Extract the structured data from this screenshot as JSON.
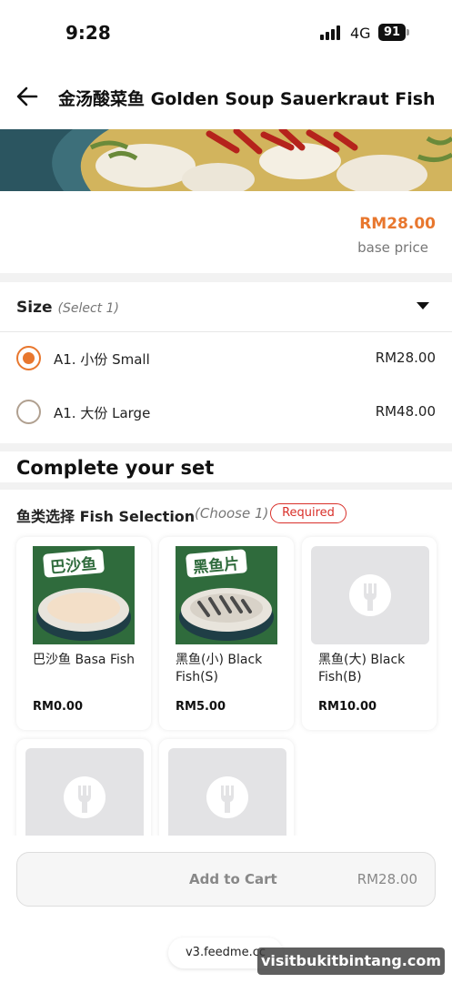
{
  "status_bar": {
    "time": "9:28",
    "network": "4G",
    "battery": "91"
  },
  "header": {
    "title": "金汤酸菜鱼 Golden Soup Sauerkraut Fish"
  },
  "price": {
    "amount": "RM28.00",
    "caption": "base price"
  },
  "size": {
    "heading": "Size",
    "hint": "(Select 1)",
    "options": [
      {
        "label": "A1. 小份 Small",
        "price": "RM28.00",
        "selected": true
      },
      {
        "label": "A1. 大份 Large",
        "price": "RM48.00",
        "selected": false
      }
    ]
  },
  "set": {
    "title": "Complete your set"
  },
  "fish": {
    "heading": "鱼类选择 Fish Selection",
    "hint": "(Choose 1)",
    "required": "Required",
    "items": [
      {
        "name": "巴沙鱼 Basa Fish",
        "price": "RM0.00",
        "badge": "巴沙鱼"
      },
      {
        "name": "黑鱼(小) Black Fish(S)",
        "price": "RM5.00",
        "badge": "黑鱼片"
      },
      {
        "name": "黑鱼(大) Black Fish(B)",
        "price": "RM10.00"
      },
      {
        "name": "",
        "price": ""
      },
      {
        "name": "",
        "price": ""
      }
    ]
  },
  "cart": {
    "label": "Add to Cart",
    "price": "RM28.00"
  },
  "footer": {
    "url": "v3.feedme.cc",
    "watermark": "visitbukitbintang.com"
  },
  "colors": {
    "accent": "#e8772e",
    "required": "#d9302a",
    "food_bg": "#2f6b3c"
  }
}
